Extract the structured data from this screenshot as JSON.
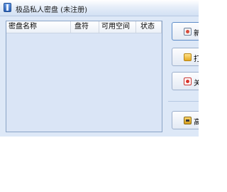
{
  "window": {
    "title": "极品私人密盘 (未注册)"
  },
  "table": {
    "columns": [
      "密盘名称",
      "盘符",
      "可用空间",
      "状态"
    ],
    "rows": []
  },
  "buttons": {
    "new_label": "新",
    "open_label": "打",
    "close_label": "关",
    "advanced_label": "高"
  },
  "icons": {
    "app": "app-icon",
    "new": "new-disk-icon",
    "open": "open-folder-icon",
    "close": "close-icon",
    "advanced": "advanced-settings-icon"
  }
}
